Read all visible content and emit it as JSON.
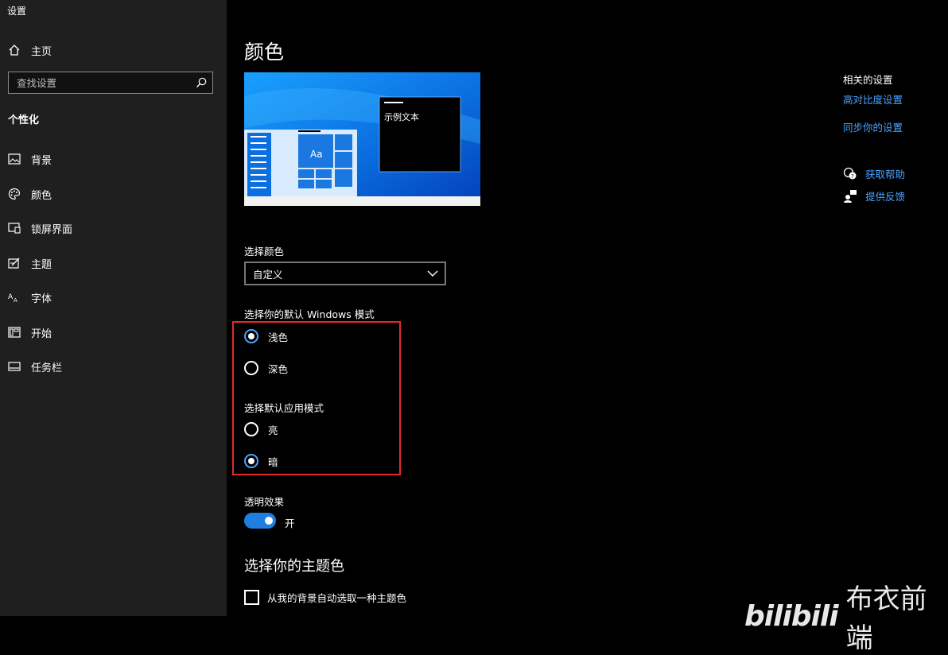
{
  "window": {
    "title": "设置"
  },
  "sidebar": {
    "home": {
      "label": "主页",
      "icon": "home-icon"
    },
    "search": {
      "placeholder": "查找设置",
      "icon": "search-icon"
    },
    "section": "个性化",
    "items": [
      {
        "label": "背景",
        "icon": "image-icon"
      },
      {
        "label": "颜色",
        "icon": "palette-icon"
      },
      {
        "label": "锁屏界面",
        "icon": "lock-screen-icon"
      },
      {
        "label": "主题",
        "icon": "theme-icon"
      },
      {
        "label": "字体",
        "icon": "font-icon"
      },
      {
        "label": "开始",
        "icon": "start-icon"
      },
      {
        "label": "任务栏",
        "icon": "taskbar-icon"
      }
    ]
  },
  "main": {
    "title": "颜色",
    "preview": {
      "sample_text": "示例文本",
      "tile_text": "Aa"
    },
    "choose_color": {
      "label": "选择颜色",
      "value": "自定义"
    },
    "windows_mode": {
      "label": "选择你的默认 Windows 模式",
      "options": [
        {
          "label": "浅色",
          "selected": true
        },
        {
          "label": "深色",
          "selected": false
        }
      ]
    },
    "app_mode": {
      "label": "选择默认应用模式",
      "options": [
        {
          "label": "亮",
          "selected": false
        },
        {
          "label": "暗",
          "selected": true
        }
      ]
    },
    "transparency": {
      "label": "透明效果",
      "state": "开",
      "on": true
    },
    "accent": {
      "title": "选择你的主题色",
      "auto_pick": {
        "label": "从我的背景自动选取一种主题色",
        "checked": false
      }
    }
  },
  "related": {
    "heading": "相关的设置",
    "links": [
      "高对比度设置",
      "同步你的设置"
    ],
    "help": [
      {
        "label": "获取帮助",
        "icon": "help-chat-icon"
      },
      {
        "label": "提供反馈",
        "icon": "feedback-icon"
      }
    ]
  },
  "watermark": {
    "logo": "bilibili",
    "text": "布衣前端"
  },
  "colors": {
    "accent": "#1f7fe0",
    "link": "#4aa3ff",
    "highlight": "#e52a2a",
    "sidebar": "#1f1f1f"
  }
}
